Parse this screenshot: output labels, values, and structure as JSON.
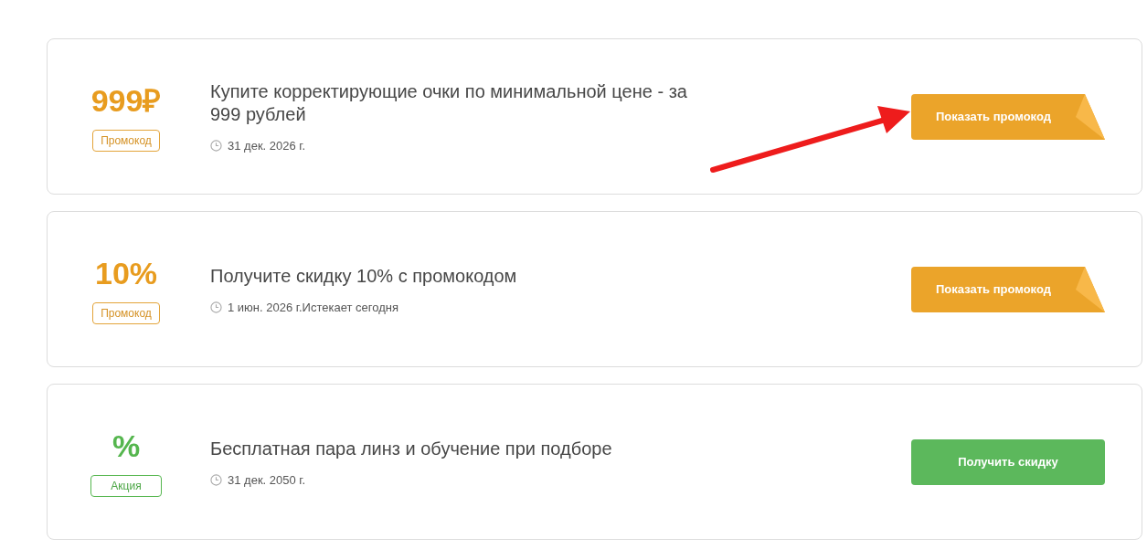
{
  "offers": [
    {
      "kind": "promo",
      "value": "999₽",
      "badge": "Промокод",
      "title": "Купите корректирующие очки по минимальной цене - за 999 рублей",
      "date": "31 дек. 2026 г.",
      "button": "Показать промокод"
    },
    {
      "kind": "promo",
      "value": "10%",
      "badge": "Промокод",
      "title": "Получите скидку 10% с промокодом",
      "date": "1 июн. 2026 г.",
      "note": "Истекает сегодня",
      "button": "Показать промокод"
    },
    {
      "kind": "deal",
      "value": "%",
      "badge": "Акция",
      "title": "Бесплатная пара линз и обучение при подборе",
      "date": "31 дек. 2050 г.",
      "button": "Получить скидку"
    }
  ]
}
